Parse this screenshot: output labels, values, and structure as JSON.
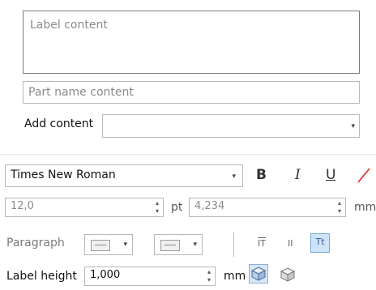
{
  "label_box": {
    "placeholder": "Label content"
  },
  "part_name": {
    "placeholder": "Part name content"
  },
  "add_content": {
    "label": "Add content",
    "value": ""
  },
  "font": {
    "family": "Times New Roman",
    "bold_label": "B",
    "italic_label": "I",
    "underline_label": "U",
    "size": "12,0",
    "size_unit": "pt",
    "size_mm": "4,234",
    "size_mm_unit": "mm"
  },
  "paragraph": {
    "label": "Paragraph",
    "valign_top_label": "IT",
    "valign_middle_label": "II",
    "valign_fit_label": "Tt"
  },
  "label_height": {
    "label": "Label height",
    "value": "1,000",
    "unit": "mm"
  },
  "icons": {
    "spinner_arrows": "⌃⌄",
    "dropdown": "⌄"
  },
  "colors": {
    "accent": "#cfe3f7",
    "clear_format": "#e04a4a"
  }
}
